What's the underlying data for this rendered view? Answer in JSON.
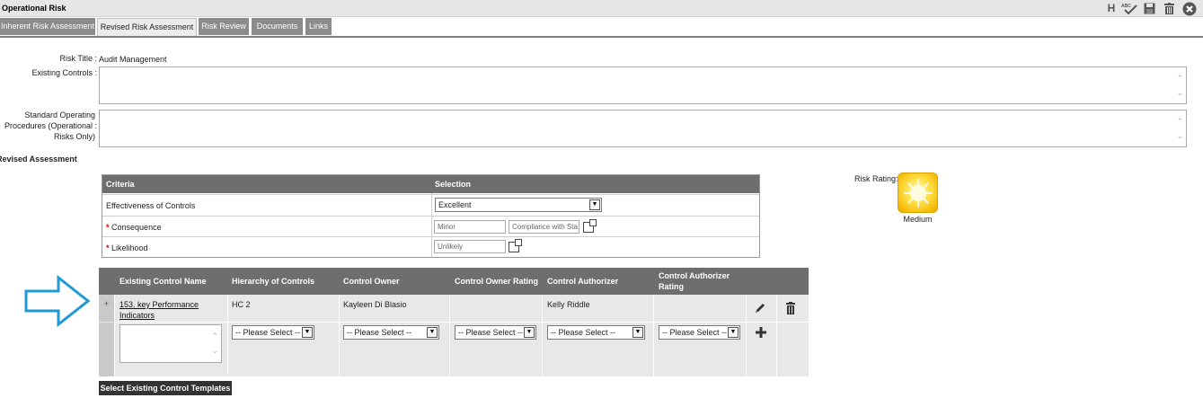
{
  "window": {
    "title": "Operational Risk"
  },
  "toolbar": {
    "h_label": "H",
    "spell_label": "ABC",
    "icons": [
      "spellcheck-icon",
      "save-icon",
      "print-icon",
      "close-icon"
    ]
  },
  "tabs": [
    {
      "label": "Inherent Risk Assessment",
      "active": false
    },
    {
      "label": "Revised Risk Assessment",
      "active": true
    },
    {
      "label": "Risk Review",
      "active": false
    },
    {
      "label": "Documents",
      "active": false
    },
    {
      "label": "Links",
      "active": false
    }
  ],
  "form": {
    "risk_title_label": "Risk Title :",
    "risk_title_value": "Audit Management",
    "existing_controls_label": "Existing Controls :",
    "sop_label_1": "Standard Operating",
    "sop_label_2": "Procedures (Operational :",
    "sop_label_3": "Risks Only)"
  },
  "revised_assessment": {
    "section_label": "Revised Assessment",
    "headers": {
      "criteria": "Criteria",
      "selection": "Selection"
    },
    "rows": {
      "effectiveness_label": "Effectiveness of Controls",
      "effectiveness_value": "Excellent",
      "consequence_label": "Consequence",
      "consequence_value": "Minor",
      "consequence_category": "Compliance with Sta",
      "likelihood_label": "Likelihood",
      "likelihood_value": "Unlikely"
    },
    "required_mark": "*"
  },
  "risk_rating": {
    "label": "Risk Rating:",
    "value": "Medium",
    "color": "#f5b800"
  },
  "controls_grid": {
    "headers": {
      "name": "Existing Control Name",
      "hierarchy": "Hierarchy of Controls",
      "owner": "Control Owner",
      "owner_rating": "Control Owner Rating",
      "authorizer": "Control Authorizer",
      "authorizer_rating_1": "Control Authorizer",
      "authorizer_rating_2": "Rating"
    },
    "row": {
      "expand": "+",
      "name_line1": "153. key Performance",
      "name_line2": "Indicators",
      "hierarchy": "HC 2",
      "owner": "Kayleen Di Blasio",
      "owner_rating": "",
      "authorizer": "Kelly Riddle",
      "authorizer_rating": ""
    },
    "new_row": {
      "placeholder": "-- Please Select --",
      "add_icon": "plus-icon"
    }
  },
  "buttons": {
    "select_templates": "Select Existing Control Templates"
  }
}
